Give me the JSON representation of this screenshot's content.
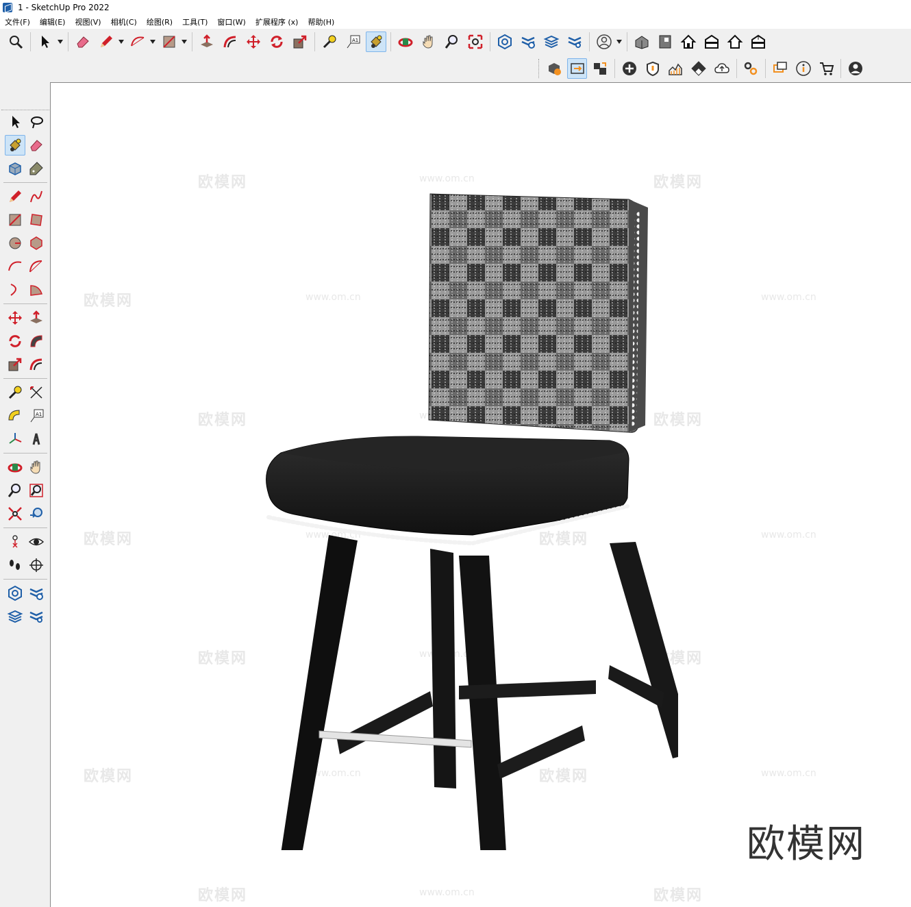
{
  "window": {
    "title": "1 - SketchUp Pro 2022"
  },
  "menu": [
    "文件(F)",
    "编辑(E)",
    "视图(V)",
    "相机(C)",
    "绘图(R)",
    "工具(T)",
    "窗口(W)",
    "扩展程序 (x)",
    "帮助(H)"
  ],
  "watermarks": {
    "cn": "欧模网",
    "url": "www.om.cn"
  },
  "brand_text": "欧模网",
  "toolbar": {
    "text_tool_label": "A1"
  },
  "colors": {
    "accent": "#1f5fa8",
    "red_tool": "#d0202a",
    "active_bg": "#cde4f7"
  }
}
